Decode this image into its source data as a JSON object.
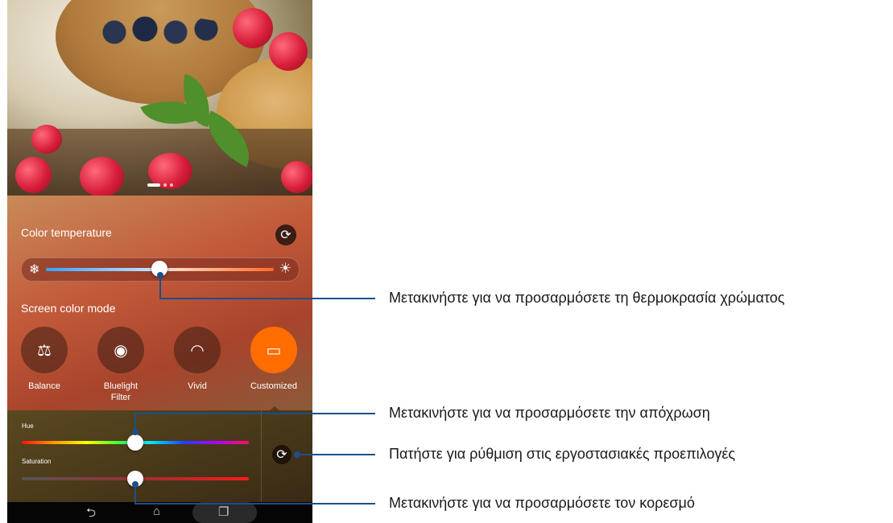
{
  "color_temperature": {
    "title": "Color temperature",
    "cold_icon": "snowflake-icon",
    "warm_icon": "sun-icon",
    "reset_icon": "refresh-icon",
    "value_fraction": 0.5
  },
  "screen_color_mode": {
    "title": "Screen color mode",
    "modes": [
      {
        "label": "Balance",
        "icon": "scale-icon"
      },
      {
        "label": "Bluelight Filter",
        "icon": "eye-shield-icon"
      },
      {
        "label": "Vivid",
        "icon": "rainbow-icon"
      },
      {
        "label": "Customized",
        "icon": "custom-screen-icon"
      }
    ],
    "selected": "Customized",
    "accent_color": "#ff6c00"
  },
  "customized": {
    "hue_label": "Hue",
    "saturation_label": "Saturation",
    "hue_fraction": 0.5,
    "saturation_fraction": 0.5,
    "reset_icon": "refresh-icon"
  },
  "navbar": {
    "back_icon": "back-icon",
    "home_icon": "home-icon",
    "recents_icon": "recents-icon"
  },
  "callouts": [
    {
      "text": "Μετακινήστε για να προσαρμόσετε τη θερμοκρασία χρώματος"
    },
    {
      "text": "Μετακινήστε για να προσαρμόσετε την απόχρωση"
    },
    {
      "text": "Πατήστε για ρύθμιση στις εργοστασιακές προεπιλογές"
    },
    {
      "text": "Μετακινήστε για να προσαρμόσετε τον κορεσμό"
    }
  ],
  "callout_color": "#1c4f8a"
}
